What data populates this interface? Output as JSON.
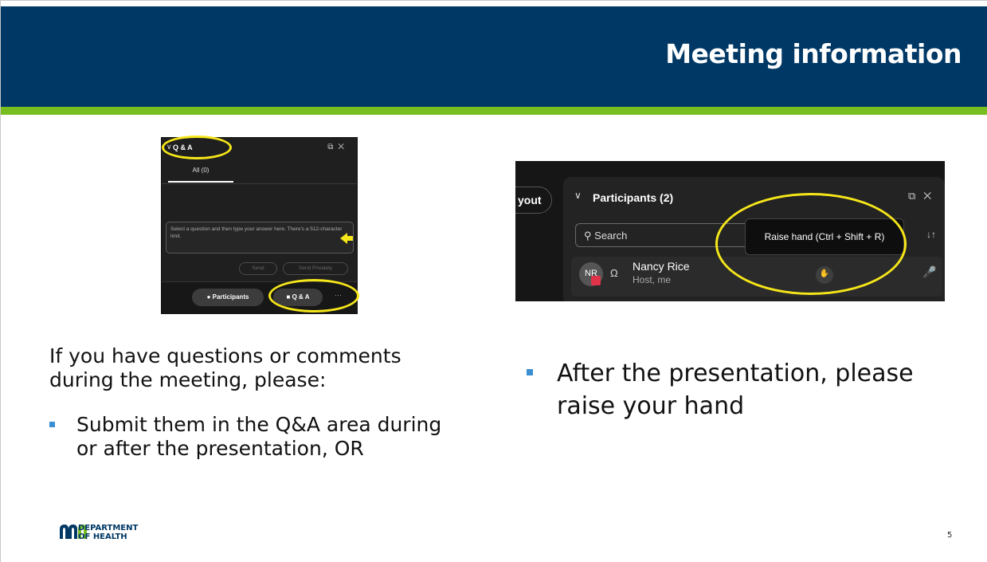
{
  "header": {
    "title": "Meeting information"
  },
  "qa_panel": {
    "title": "Q & A",
    "tab_all": "All (0)",
    "input_placeholder": "Select a question and then type your answer here. There's a 512-character limit.",
    "send_label": "Send",
    "send_privately_label": "Send Privately",
    "participants_button": "Participants",
    "qa_button": "Q & A",
    "more": "···"
  },
  "participants_panel": {
    "layout_fragment": "yout",
    "title": "Participants (2)",
    "search_placeholder": "Search",
    "tooltip": "Raise hand (Ctrl + Shift + R)",
    "participant": {
      "initials": "NR",
      "name": "Nancy Rice",
      "role": "Host, me"
    }
  },
  "left": {
    "intro": "If you have questions or comments during the meeting, please:",
    "bullet": "Submit them in the Q&A area during or after the presentation, OR"
  },
  "right": {
    "bullet": "After the presentation, please raise your hand"
  },
  "footer": {
    "logo_line1": "DEPARTMENT",
    "logo_line2": "OF HEALTH",
    "page_number": "5"
  },
  "colors": {
    "header_navy": "#003865",
    "header_green": "#78be21",
    "highlight_yellow": "#f5e61a",
    "bullet_blue": "#3b8fd1"
  }
}
